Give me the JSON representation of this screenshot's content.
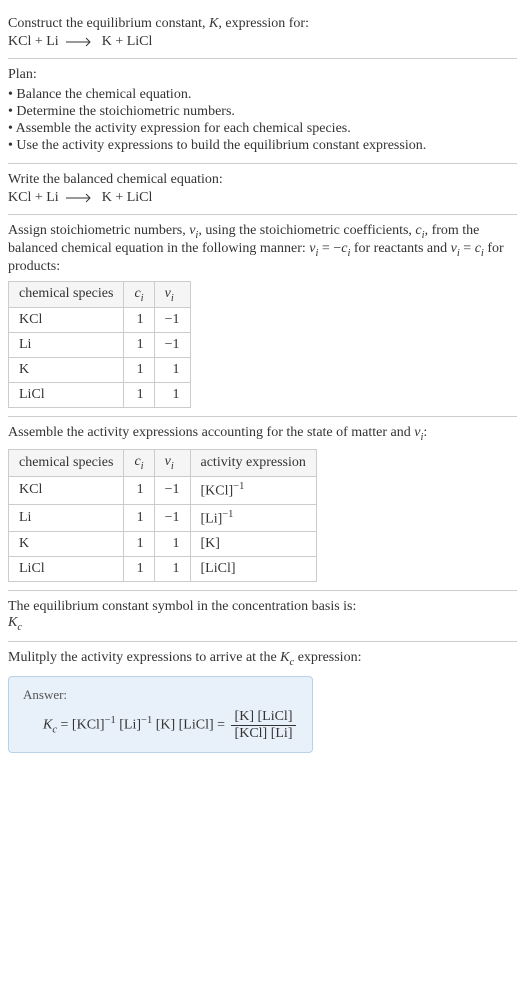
{
  "header": {
    "prompt_prefix": "Construct the equilibrium constant, ",
    "K": "K",
    "prompt_suffix": ", expression for:",
    "equation_lhs1": "KCl",
    "plus": " + ",
    "equation_lhs2": "Li",
    "equation_rhs1": "K",
    "equation_rhs2": "LiCl"
  },
  "plan": {
    "title": "Plan:",
    "items": [
      "• Balance the chemical equation.",
      "• Determine the stoichiometric numbers.",
      "• Assemble the activity expression for each chemical species.",
      "• Use the activity expressions to build the equilibrium constant expression."
    ]
  },
  "balanced": {
    "title": "Write the balanced chemical equation:",
    "lhs1": "KCl",
    "lhs2": "Li",
    "rhs1": "K",
    "rhs2": "LiCl"
  },
  "stoich": {
    "intro_a": "Assign stoichiometric numbers, ",
    "nu": "ν",
    "i": "i",
    "intro_b": ", using the stoichiometric coefficients, ",
    "c": "c",
    "intro_c": ", from the balanced chemical equation in the following manner: ",
    "rel1_a": "ν",
    "rel1_b": " = −",
    "rel1_c": "c",
    "rel1_d": " for reactants and ",
    "rel2_a": "ν",
    "rel2_b": " = ",
    "rel2_c": "c",
    "rel2_d": " for products:",
    "headers": {
      "species": "chemical species",
      "ci": "c",
      "nui": "ν"
    },
    "rows": [
      {
        "species": "KCl",
        "ci": "1",
        "nui": "−1"
      },
      {
        "species": "Li",
        "ci": "1",
        "nui": "−1"
      },
      {
        "species": "K",
        "ci": "1",
        "nui": "1"
      },
      {
        "species": "LiCl",
        "ci": "1",
        "nui": "1"
      }
    ]
  },
  "activity": {
    "intro_a": "Assemble the activity expressions accounting for the state of matter and ",
    "intro_b": ":",
    "headers": {
      "species": "chemical species",
      "ci": "c",
      "nui": "ν",
      "act": "activity expression"
    },
    "rows": [
      {
        "species": "KCl",
        "ci": "1",
        "nui": "−1",
        "act_base": "[KCl]",
        "act_exp": "−1"
      },
      {
        "species": "Li",
        "ci": "1",
        "nui": "−1",
        "act_base": "[Li]",
        "act_exp": "−1"
      },
      {
        "species": "K",
        "ci": "1",
        "nui": "1",
        "act_base": "[K]",
        "act_exp": ""
      },
      {
        "species": "LiCl",
        "ci": "1",
        "nui": "1",
        "act_base": "[LiCl]",
        "act_exp": ""
      }
    ]
  },
  "symbol": {
    "line1": "The equilibrium constant symbol in the concentration basis is:",
    "K": "K",
    "c": "c"
  },
  "multiply": {
    "line_a": "Mulitply the activity expressions to arrive at the ",
    "K": "K",
    "c": "c",
    "line_b": " expression:"
  },
  "answer": {
    "label": "Answer:",
    "K": "K",
    "c": "c",
    "eq": " = ",
    "t1": "[KCl]",
    "e1": "−1",
    "t2": "[Li]",
    "e2": "−1",
    "t3": "[K]",
    "t4": "[LiCl]",
    "eq2": " = ",
    "num": "[K] [LiCl]",
    "den": "[KCl] [Li]"
  },
  "chart_data": {
    "type": "table",
    "tables": [
      {
        "title": "stoichiometric numbers",
        "columns": [
          "chemical species",
          "c_i",
          "ν_i"
        ],
        "rows": [
          [
            "KCl",
            1,
            -1
          ],
          [
            "Li",
            1,
            -1
          ],
          [
            "K",
            1,
            1
          ],
          [
            "LiCl",
            1,
            1
          ]
        ]
      },
      {
        "title": "activity expressions",
        "columns": [
          "chemical species",
          "c_i",
          "ν_i",
          "activity expression"
        ],
        "rows": [
          [
            "KCl",
            1,
            -1,
            "[KCl]^-1"
          ],
          [
            "Li",
            1,
            -1,
            "[Li]^-1"
          ],
          [
            "K",
            1,
            1,
            "[K]"
          ],
          [
            "LiCl",
            1,
            1,
            "[LiCl]"
          ]
        ]
      }
    ]
  }
}
